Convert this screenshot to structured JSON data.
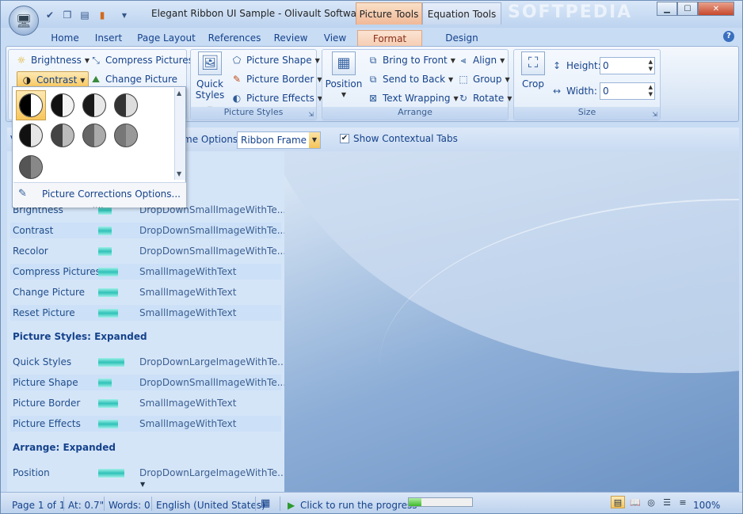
{
  "window": {
    "title": "Elegant Ribbon UI Sample - Olivault Software",
    "context_tabs": [
      "Picture Tools",
      "Equation Tools"
    ],
    "watermark": "SOFTPEDIA",
    "controls": {
      "minimize": "▁",
      "maximize": "☐",
      "close": "✕"
    }
  },
  "tabs": [
    "Home",
    "Insert",
    "Page Layout",
    "References",
    "Review",
    "View",
    "Format",
    "Design"
  ],
  "active_tab": "Format",
  "ribbon": {
    "adjust": {
      "brightness": "Brightness",
      "contrast": "Contrast",
      "compress": "Compress Pictures",
      "change": "Change Picture"
    },
    "picture_styles": {
      "quick_styles_1": "Quick",
      "quick_styles_2": "Styles",
      "shape": "Picture Shape",
      "border": "Picture Border",
      "effects": "Picture Effects",
      "label": "Picture Styles"
    },
    "arrange": {
      "position": "Position",
      "bring_front": "Bring to Front",
      "send_back": "Send to Back",
      "text_wrapping": "Text Wrapping",
      "align": "Align",
      "group": "Group",
      "rotate": "Rotate",
      "label": "Arrange"
    },
    "size": {
      "crop": "Crop",
      "height_label": "Height:",
      "height_value": "0",
      "width_label": "Width:",
      "width_value": "0",
      "label": "Size"
    }
  },
  "gallery": {
    "footer": "Picture Corrections Options...",
    "grip": "....",
    "levels": [
      0.5,
      0.5,
      0.5,
      0.5,
      0.5,
      0.5,
      0.5,
      0.5,
      0.5
    ]
  },
  "options": {
    "label_partial": "me Options",
    "frame_value": "Ribbon Frame",
    "show_contextual": "Show Contextual Tabs",
    "prefix": "V"
  },
  "list": {
    "rows_top": [
      {
        "name": "Brightness",
        "bar": 0.3,
        "type": "DropDownSmallImageWithTe..."
      },
      {
        "name": "Contrast",
        "bar": 0.3,
        "type": "DropDownSmallImageWithTe..."
      },
      {
        "name": "Recolor",
        "bar": 0.3,
        "type": "DropDownSmallImageWithTe..."
      },
      {
        "name": "Compress Pictures",
        "bar": 0.45,
        "type": "SmallImageWithText"
      },
      {
        "name": "Change Picture",
        "bar": 0.45,
        "type": "SmallImageWithText"
      },
      {
        "name": "Reset Picture",
        "bar": 0.45,
        "type": "SmallImageWithText"
      }
    ],
    "heading_styles": "Picture Styles: Expanded",
    "rows_styles": [
      {
        "name": "Quick Styles",
        "bar": 0.6,
        "type": "DropDownLargeImageWithTe..."
      },
      {
        "name": "Picture Shape",
        "bar": 0.3,
        "type": "DropDownSmallImageWithTe..."
      },
      {
        "name": "Picture Border",
        "bar": 0.45,
        "type": "SmallImageWithText"
      },
      {
        "name": "Picture Effects",
        "bar": 0.45,
        "type": "SmallImageWithText"
      }
    ],
    "heading_arrange": "Arrange: Expanded",
    "rows_arrange": [
      {
        "name": "Position",
        "bar": 0.6,
        "type": "DropDownLargeImageWithTe..."
      }
    ]
  },
  "status": {
    "page": "Page 1 of 1",
    "at": "At: 0.7\"",
    "words": "Words: 0",
    "language": "English (United States)",
    "progress_text": "Click to run the progress",
    "progress": 0.2,
    "zoom": "100%"
  }
}
